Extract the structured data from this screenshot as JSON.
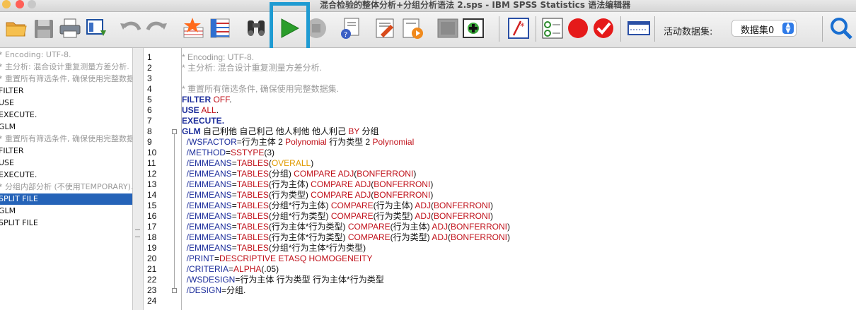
{
  "window": {
    "title": "混合检验的整体分析+分组分析语法 2.sps - IBM SPSS Statistics 语法编辑器"
  },
  "toolbar": {
    "buttons": [
      {
        "name": "open-file-icon"
      },
      {
        "name": "save-icon"
      },
      {
        "name": "print-icon"
      },
      {
        "name": "recall-dialog-icon"
      },
      {
        "name": "undo-icon"
      },
      {
        "name": "redo-icon"
      },
      {
        "name": "goto-case-icon"
      },
      {
        "name": "variables-icon"
      },
      {
        "name": "find-icon"
      },
      {
        "name": "run-selection-icon"
      },
      {
        "name": "stop-icon"
      },
      {
        "name": "syntax-help-icon"
      },
      {
        "name": "use-variable-sets-icon"
      },
      {
        "name": "edit-syntax-icon"
      },
      {
        "name": "play-audio-icon"
      },
      {
        "name": "gray-square-icon"
      },
      {
        "name": "add-bookmark-icon"
      },
      {
        "name": "comment-icon"
      },
      {
        "name": "validate-icon"
      },
      {
        "name": "breakpoint-icon"
      },
      {
        "name": "check-icon"
      },
      {
        "name": "toggle-pane-icon"
      },
      {
        "name": "search-icon"
      }
    ],
    "dataset_label": "活动数据集:",
    "dataset_value": "数据集0"
  },
  "outline": {
    "items": [
      {
        "text": "* Encoding: UTF-8.",
        "type": "comment",
        "selected": false
      },
      {
        "text": "* 主分析: 混合设计重复测量方差分析.",
        "type": "comment",
        "selected": false
      },
      {
        "text": "* 重置所有筛选条件, 确保使用完整数据集.",
        "type": "comment",
        "selected": false
      },
      {
        "text": "FILTER",
        "type": "command",
        "selected": false
      },
      {
        "text": "USE",
        "type": "command",
        "selected": false
      },
      {
        "text": "EXECUTE.",
        "type": "command",
        "selected": false
      },
      {
        "text": "GLM",
        "type": "command",
        "selected": false
      },
      {
        "text": "* 重置所有筛选条件, 确保使用完整数据集.",
        "type": "comment",
        "selected": false
      },
      {
        "text": "FILTER",
        "type": "command",
        "selected": false
      },
      {
        "text": "USE",
        "type": "command",
        "selected": false
      },
      {
        "text": "EXECUTE.",
        "type": "command",
        "selected": false
      },
      {
        "text": "* 分组内部分析 (不使用TEMPORARY).",
        "type": "comment",
        "selected": false
      },
      {
        "text": "SPLIT FILE",
        "type": "command",
        "selected": true
      },
      {
        "text": "GLM",
        "type": "command",
        "selected": false
      },
      {
        "text": "SPLIT FILE",
        "type": "command",
        "selected": false
      }
    ]
  },
  "editor": {
    "line_numbers": [
      "1",
      "2",
      "3",
      "4",
      "5",
      "6",
      "7",
      "8",
      "9",
      "10",
      "11",
      "12",
      "13",
      "14",
      "15",
      "16",
      "17",
      "18",
      "19",
      "20",
      "21",
      "22",
      "23",
      "24"
    ],
    "lines": [
      [
        {
          "t": "* Encoding: UTF-8.",
          "c": "c"
        }
      ],
      [
        {
          "t": "* 主分析: 混合设计重复测量方差分析.",
          "c": "c"
        }
      ],
      [],
      [
        {
          "t": "* 重置所有筛选条件, 确保使用完整数据集.",
          "c": "c"
        }
      ],
      [
        {
          "t": "FILTER",
          "c": "k"
        },
        {
          "t": " ",
          "c": "t"
        },
        {
          "t": "OFF",
          "c": "v"
        },
        {
          "t": ".",
          "c": "t"
        }
      ],
      [
        {
          "t": "USE",
          "c": "k"
        },
        {
          "t": " ",
          "c": "t"
        },
        {
          "t": "ALL",
          "c": "v"
        },
        {
          "t": ".",
          "c": "t"
        }
      ],
      [
        {
          "t": "EXECUTE",
          "c": "k"
        },
        {
          "t": ".",
          "c": "k"
        }
      ],
      [
        {
          "t": "GLM",
          "c": "k"
        },
        {
          "t": " 自己利他 自己利己 他人利他 他人利己 ",
          "c": "t"
        },
        {
          "t": "BY",
          "c": "v"
        },
        {
          "t": " 分组",
          "c": "t"
        }
      ],
      [
        {
          "t": "  /WSFACTOR",
          "c": "s"
        },
        {
          "t": "=行为主体 2 ",
          "c": "t"
        },
        {
          "t": "Polynomial",
          "c": "v"
        },
        {
          "t": " 行为类型 2 ",
          "c": "t"
        },
        {
          "t": "Polynomial",
          "c": "v"
        }
      ],
      [
        {
          "t": "  /METHOD",
          "c": "s"
        },
        {
          "t": "=",
          "c": "t"
        },
        {
          "t": "SSTYPE",
          "c": "v"
        },
        {
          "t": "(3)",
          "c": "t"
        }
      ],
      [
        {
          "t": "  /EMMEANS",
          "c": "s"
        },
        {
          "t": "=",
          "c": "t"
        },
        {
          "t": "TABLES",
          "c": "v"
        },
        {
          "t": "(",
          "c": "t"
        },
        {
          "t": "OVERALL",
          "c": "o"
        },
        {
          "t": ")",
          "c": "t"
        }
      ],
      [
        {
          "t": "  /EMMEANS",
          "c": "s"
        },
        {
          "t": "=",
          "c": "t"
        },
        {
          "t": "TABLES",
          "c": "v"
        },
        {
          "t": "(分组) ",
          "c": "t"
        },
        {
          "t": "COMPARE ADJ",
          "c": "v"
        },
        {
          "t": "(",
          "c": "t"
        },
        {
          "t": "BONFERRONI",
          "c": "v"
        },
        {
          "t": ")",
          "c": "t"
        }
      ],
      [
        {
          "t": "  /EMMEANS",
          "c": "s"
        },
        {
          "t": "=",
          "c": "t"
        },
        {
          "t": "TABLES",
          "c": "v"
        },
        {
          "t": "(行为主体) ",
          "c": "t"
        },
        {
          "t": "COMPARE ADJ",
          "c": "v"
        },
        {
          "t": "(",
          "c": "t"
        },
        {
          "t": "BONFERRONI",
          "c": "v"
        },
        {
          "t": ")",
          "c": "t"
        }
      ],
      [
        {
          "t": "  /EMMEANS",
          "c": "s"
        },
        {
          "t": "=",
          "c": "t"
        },
        {
          "t": "TABLES",
          "c": "v"
        },
        {
          "t": "(行为类型) ",
          "c": "t"
        },
        {
          "t": "COMPARE ADJ",
          "c": "v"
        },
        {
          "t": "(",
          "c": "t"
        },
        {
          "t": "BONFERRONI",
          "c": "v"
        },
        {
          "t": ")",
          "c": "t"
        }
      ],
      [
        {
          "t": "  /EMMEANS",
          "c": "s"
        },
        {
          "t": "=",
          "c": "t"
        },
        {
          "t": "TABLES",
          "c": "v"
        },
        {
          "t": "(分组*行为主体) ",
          "c": "t"
        },
        {
          "t": "COMPARE",
          "c": "v"
        },
        {
          "t": "(行为主体) ",
          "c": "t"
        },
        {
          "t": "ADJ",
          "c": "v"
        },
        {
          "t": "(",
          "c": "t"
        },
        {
          "t": "BONFERRONI",
          "c": "v"
        },
        {
          "t": ")",
          "c": "t"
        }
      ],
      [
        {
          "t": "  /EMMEANS",
          "c": "s"
        },
        {
          "t": "=",
          "c": "t"
        },
        {
          "t": "TABLES",
          "c": "v"
        },
        {
          "t": "(分组*行为类型) ",
          "c": "t"
        },
        {
          "t": "COMPARE",
          "c": "v"
        },
        {
          "t": "(行为类型) ",
          "c": "t"
        },
        {
          "t": "ADJ",
          "c": "v"
        },
        {
          "t": "(",
          "c": "t"
        },
        {
          "t": "BONFERRONI",
          "c": "v"
        },
        {
          "t": ")",
          "c": "t"
        }
      ],
      [
        {
          "t": "  /EMMEANS",
          "c": "s"
        },
        {
          "t": "=",
          "c": "t"
        },
        {
          "t": "TABLES",
          "c": "v"
        },
        {
          "t": "(行为主体*行为类型) ",
          "c": "t"
        },
        {
          "t": "COMPARE",
          "c": "v"
        },
        {
          "t": "(行为主体) ",
          "c": "t"
        },
        {
          "t": "ADJ",
          "c": "v"
        },
        {
          "t": "(",
          "c": "t"
        },
        {
          "t": "BONFERRONI",
          "c": "v"
        },
        {
          "t": ")",
          "c": "t"
        }
      ],
      [
        {
          "t": "  /EMMEANS",
          "c": "s"
        },
        {
          "t": "=",
          "c": "t"
        },
        {
          "t": "TABLES",
          "c": "v"
        },
        {
          "t": "(行为主体*行为类型) ",
          "c": "t"
        },
        {
          "t": "COMPARE",
          "c": "v"
        },
        {
          "t": "(行为类型) ",
          "c": "t"
        },
        {
          "t": "ADJ",
          "c": "v"
        },
        {
          "t": "(",
          "c": "t"
        },
        {
          "t": "BONFERRONI",
          "c": "v"
        },
        {
          "t": ")",
          "c": "t"
        }
      ],
      [
        {
          "t": "  /EMMEANS",
          "c": "s"
        },
        {
          "t": "=",
          "c": "t"
        },
        {
          "t": "TABLES",
          "c": "v"
        },
        {
          "t": "(分组*行为主体*行为类型)",
          "c": "t"
        }
      ],
      [
        {
          "t": "  /PRINT",
          "c": "s"
        },
        {
          "t": "=",
          "c": "t"
        },
        {
          "t": "DESCRIPTIVE ETASQ HOMOGENEITY",
          "c": "v"
        }
      ],
      [
        {
          "t": "  /CRITERIA",
          "c": "s"
        },
        {
          "t": "=",
          "c": "t"
        },
        {
          "t": "ALPHA",
          "c": "v"
        },
        {
          "t": "(.05)",
          "c": "t"
        }
      ],
      [
        {
          "t": "  /WSDESIGN",
          "c": "s"
        },
        {
          "t": "=行为主体 行为类型 行为主体*行为类型",
          "c": "t"
        }
      ],
      [
        {
          "t": "  /DESIGN",
          "c": "s"
        },
        {
          "t": "=分组.",
          "c": "t"
        }
      ],
      []
    ]
  },
  "colors": {
    "keyword": "#1c2d9b",
    "value": "#c0111a",
    "comment": "#9a9a9a",
    "highlight": "#1f9bd2",
    "selection": "#2563b8"
  }
}
